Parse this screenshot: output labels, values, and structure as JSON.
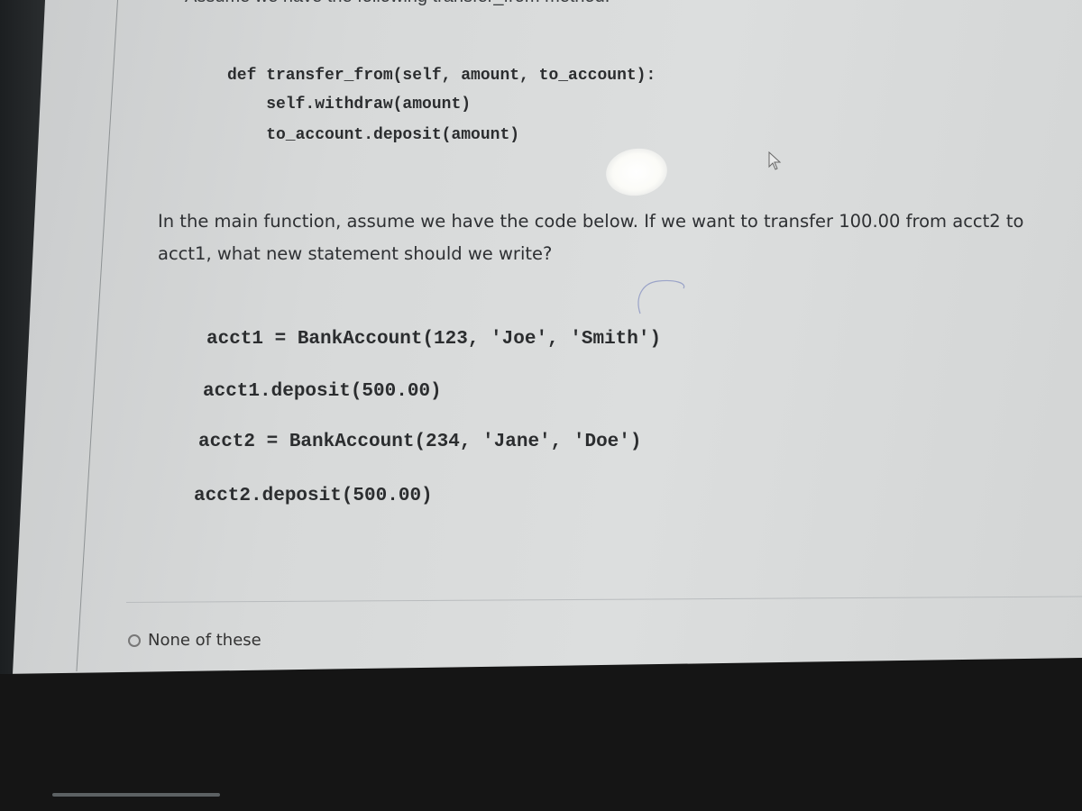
{
  "question": {
    "intro": "Assume we have the following transfer_from method:",
    "method_code": [
      "def transfer_from(self, amount, to_account):",
      "    self.withdraw(amount)",
      "    to_account.deposit(amount)"
    ],
    "prompt": "In the main function, assume we have the code below.  If we want to transfer 100.00 from acct2 to acct1, what new statement should we write?",
    "main_code": [
      "acct1 = BankAccount(123, 'Joe', 'Smith')",
      "acct1.deposit(500.00)",
      "acct2 = BankAccount(234, 'Jane', 'Doe')",
      "acct2.deposit(500.00)"
    ]
  },
  "answers": [
    {
      "label": "None of these",
      "selected": false
    }
  ],
  "icons": {
    "cursor": "mouse-pointer-icon",
    "radio": "radio-unchecked-icon"
  },
  "colors": {
    "page_background": "#d8dadb",
    "text": "#2e3033",
    "bezel": "#151515"
  }
}
